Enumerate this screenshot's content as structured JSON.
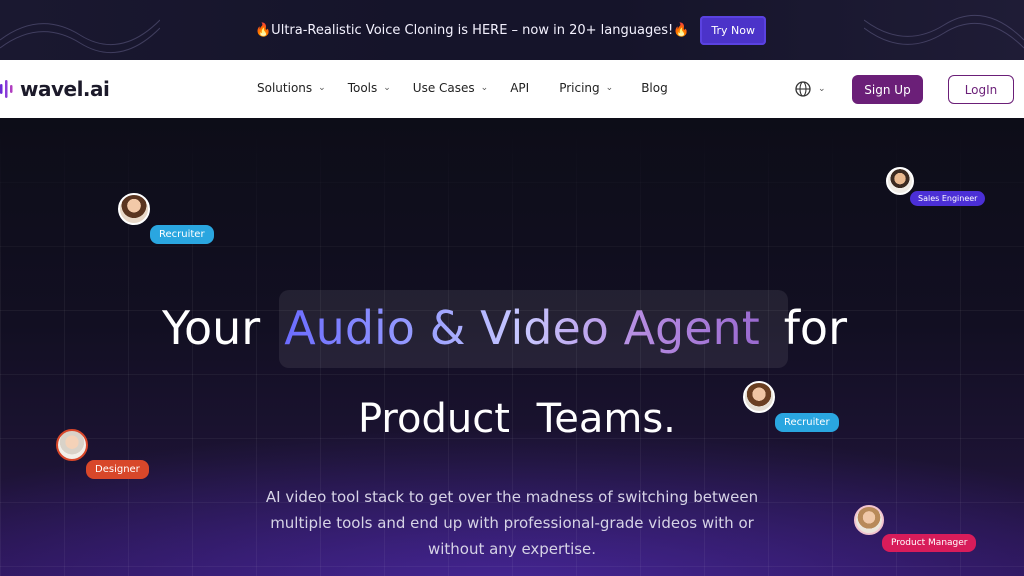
{
  "announcement": {
    "text": "🔥Ultra-Realistic Voice Cloning is HERE – now in 20+ languages!🔥",
    "cta_label": "Try Now"
  },
  "nav": {
    "logo_text": "wavel.ai",
    "items": [
      {
        "label": "Solutions",
        "has_dropdown": true
      },
      {
        "label": "Tools",
        "has_dropdown": true
      },
      {
        "label": "Use Cases",
        "has_dropdown": true
      },
      {
        "label": "API",
        "has_dropdown": false
      },
      {
        "label": "Pricing",
        "has_dropdown": true
      },
      {
        "label": "Blog",
        "has_dropdown": false
      }
    ],
    "language_icon": "globe-icon",
    "signup_label": "Sign Up",
    "login_label": "LogIn"
  },
  "hero": {
    "headline_prefix": "Your",
    "headline_highlight": "Audio & Video Agent",
    "headline_suffix": "for",
    "headline_line2": "Product Teams.",
    "description": "AI video tool stack to get over the madness of switching between multiple tools and end up with professional-grade videos with or without any expertise."
  },
  "personas": [
    {
      "label": "Recruiter",
      "color": "#2aa6e0"
    },
    {
      "label": "Sales Engineer",
      "color": "#4b2fd6"
    },
    {
      "label": "Recruiter",
      "color": "#2aa6e0"
    },
    {
      "label": "Designer",
      "color": "#d8472a"
    },
    {
      "label": "Product Manager",
      "color": "#d81c5a"
    }
  ],
  "colors": {
    "brand_purple": "#6b1f78",
    "try_button": "#4b33c9",
    "hero_bg": "#0d0d18"
  }
}
